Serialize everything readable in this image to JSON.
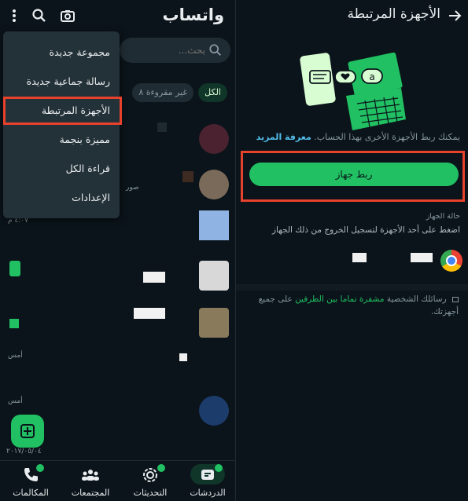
{
  "left": {
    "app_title": "واتساب",
    "search_placeholder": "بحث...",
    "filters": [
      "الكل",
      "غير مقروءة ٨"
    ],
    "time_labels": [
      "صور",
      "٤:٠٧ م",
      "أمس",
      "أمس",
      "٢٠١٧/٠٥/٠٤"
    ],
    "nav": [
      {
        "label": "الدردشات",
        "icon": "chats-icon"
      },
      {
        "label": "التحديثات",
        "icon": "updates-icon"
      },
      {
        "label": "المجتمعات",
        "icon": "communities-icon"
      },
      {
        "label": "المكالمات",
        "icon": "calls-icon"
      }
    ]
  },
  "menu": {
    "items": [
      "مجموعة جديدة",
      "رسالة جماعية جديدة",
      "الأجهزة المرتبطة",
      "مميزة بنجمة",
      "قراءة الكل",
      "الإعدادات"
    ]
  },
  "right": {
    "title": "الأجهزة المرتبطة",
    "description": "يمكنك ربط الأجهزة الأخرى بهذا الحساب.",
    "learn_more": "معرفة المزيد",
    "link_button": "ربط جهاز",
    "device_status_label": "حالة الجهاز",
    "device_hint": "اضغط على أحد الأجهزة لتسجيل الخروج من ذلك الجهاز",
    "e2e_prefix": "رسائلك الشخصية",
    "e2e_highlight": "مشفرة تماما بين الطرفين",
    "e2e_suffix": "على جميع أجهزتك."
  },
  "colors": {
    "background": "#0b141a",
    "accent_green": "#21c063",
    "menu_bg": "#233138",
    "highlight_red": "#e8412c",
    "link_blue": "#53bdeb"
  }
}
